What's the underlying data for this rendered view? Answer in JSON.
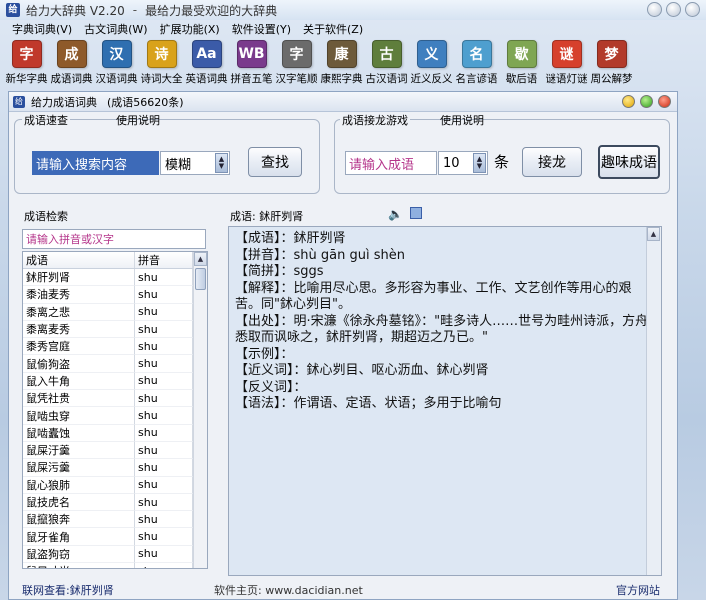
{
  "window": {
    "title": "给力大辞典 V2.20",
    "tagline": "最给力最受欢迎的大辞典"
  },
  "menu": [
    "字典词典(V)",
    "古文词典(W)",
    "扩展功能(X)",
    "软件设置(Y)",
    "关于软件(Z)"
  ],
  "toolbar": [
    {
      "label": "新华字典",
      "glyph": "字",
      "color": "#c0392b"
    },
    {
      "label": "成语词典",
      "glyph": "成",
      "color": "#8e5a2a"
    },
    {
      "label": "汉语词典",
      "glyph": "汉",
      "color": "#2f6fb0"
    },
    {
      "label": "诗词大全",
      "glyph": "诗",
      "color": "#d9a21b"
    },
    {
      "label": "英语词典",
      "glyph": "Aa",
      "color": "#3b5ba8"
    },
    {
      "label": "拼音五笔",
      "glyph": "WB",
      "color": "#7a3a8c"
    },
    {
      "label": "汉字笔顺",
      "glyph": "字",
      "color": "#6b6b6b"
    },
    {
      "label": "康熙字典",
      "glyph": "康",
      "color": "#6d5a3a"
    },
    {
      "label": "古汉语词",
      "glyph": "古",
      "color": "#5f7e3c"
    },
    {
      "label": "近义反义",
      "glyph": "义",
      "color": "#3f7fbf"
    },
    {
      "label": "名言谚语",
      "glyph": "名",
      "color": "#4e9fcf"
    },
    {
      "label": "歇后语",
      "glyph": "歇",
      "color": "#7fa653"
    },
    {
      "label": "谜语灯谜",
      "glyph": "谜",
      "color": "#d6402c"
    },
    {
      "label": "周公解梦",
      "glyph": "梦",
      "color": "#b23a2a"
    }
  ],
  "inner": {
    "title": "给力成语词典",
    "count": "(成语56620条)"
  },
  "search": {
    "group_label": "成语速查",
    "help": "使用说明",
    "input_value": "请输入搜索内容",
    "mode": "模糊",
    "button": "查找"
  },
  "game": {
    "group_label": "成语接龙游戏",
    "help": "使用说明",
    "input_value": "请输入成语",
    "count": "10",
    "unit": "条",
    "button_chain": "接龙",
    "button_fun": "趣味成语"
  },
  "list": {
    "label": "成语检索",
    "filter_placeholder": "请输入拼音或汉字",
    "col_idiom": "成语",
    "col_pinyin": "拼音",
    "rows": [
      [
        "鉥肝刿肾",
        "shu"
      ],
      [
        "黍油麦秀",
        "shu"
      ],
      [
        "黍离之悲",
        "shu"
      ],
      [
        "黍离麦秀",
        "shu"
      ],
      [
        "黍秀宫庭",
        "shu"
      ],
      [
        "鼠偷狗盗",
        "shu"
      ],
      [
        "鼠入牛角",
        "shu"
      ],
      [
        "鼠凭社贵",
        "shu"
      ],
      [
        "鼠啮虫穿",
        "shu"
      ],
      [
        "鼠啮蠹蚀",
        "shu"
      ],
      [
        "鼠屎汙羹",
        "shu"
      ],
      [
        "鼠屎污羹",
        "shu"
      ],
      [
        "鼠心狼肺",
        "shu"
      ],
      [
        "鼠技虎名",
        "shu"
      ],
      [
        "鼠攛狼奔",
        "shu"
      ],
      [
        "鼠牙雀角",
        "shu"
      ],
      [
        "鼠盗狗窃",
        "shu"
      ],
      [
        "鼠目寸光",
        "shu"
      ]
    ]
  },
  "content": {
    "heading": "成语: 鉥肝刿肾",
    "lines": [
      "【成语】：鉥肝刿肾",
      "【拼音】：shù gān guì shèn",
      "【简拼】：sggs",
      "【解释】：比喻用尽心思。多形容为事业、工作、文艺创作等用心的艰苦。同\"鉥心刿目\"。",
      "【出处】：明·宋濂《徐永舟墓铭》：\"畦多诗人……世号为畦州诗派，方舟悉取而讽咏之，鉥肝刿肾，期超迈之乃已。\"",
      "【示例】：",
      "【近义词】：鉥心刿目、呕心沥血、鉥心刿肾",
      "【反义词】：",
      "【语法】：作谓语、定语、状语；多用于比喻句"
    ]
  },
  "footer": {
    "left": "联网查看:鉥肝刿肾",
    "center": "软件主页: www.dacidian.net",
    "right": "官方网站"
  }
}
